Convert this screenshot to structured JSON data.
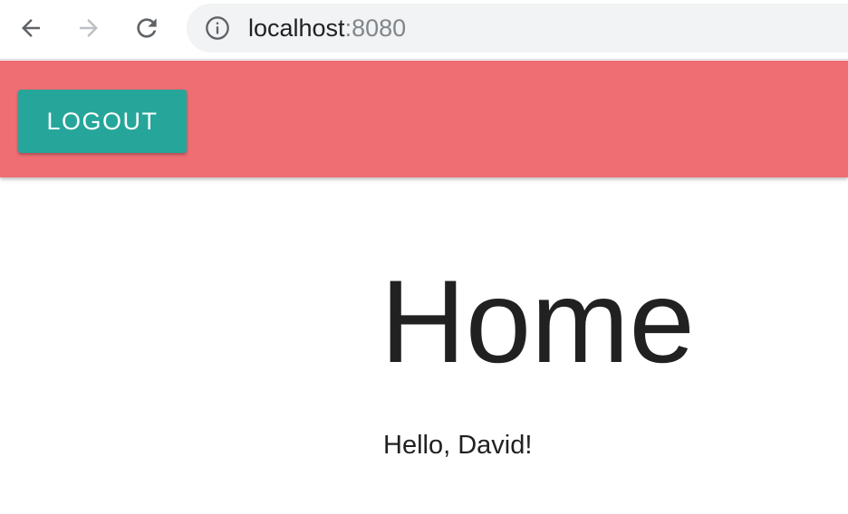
{
  "browser": {
    "url_host": "localhost",
    "url_port": ":8080",
    "icons": {
      "back": "arrow-left-icon",
      "forward": "arrow-right-icon",
      "reload": "reload-icon",
      "info": "info-icon"
    },
    "forward_enabled": false
  },
  "app_bar": {
    "color": "#ee6e73",
    "logout_label": "LOGOUT",
    "logout_color": "#26a69a"
  },
  "main": {
    "title": "Home",
    "greeting": "Hello, David!"
  }
}
